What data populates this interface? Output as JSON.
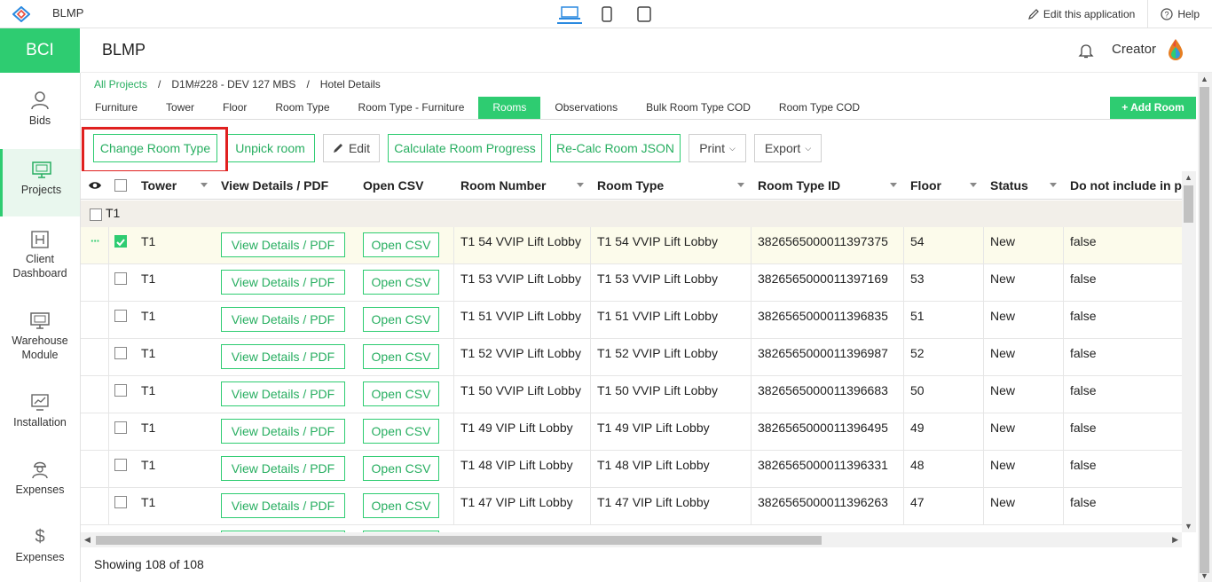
{
  "app": {
    "name": "BLMP",
    "edit_label": "Edit this application",
    "help_label": "Help",
    "brand": "BCI",
    "page_title": "BLMP",
    "user_label": "Creator"
  },
  "sidebar": {
    "items": [
      {
        "label": "Bids",
        "icon": "person-icon"
      },
      {
        "label": "Projects",
        "icon": "monitor-icon"
      },
      {
        "label": "Client Dashboard",
        "icon": "h-icon"
      },
      {
        "label": "Warehouse Module",
        "icon": "monitor-icon"
      },
      {
        "label": "Installation",
        "icon": "chart-icon"
      },
      {
        "label": "Expenses",
        "icon": "worker-icon"
      },
      {
        "label": "Expenses",
        "icon": "dollar-icon"
      }
    ]
  },
  "breadcrumb": {
    "root": "All Projects",
    "sep": "/",
    "project": "D1M#228 - DEV 127 MBS",
    "page": "Hotel Details"
  },
  "tabs": [
    "Furniture",
    "Tower",
    "Floor",
    "Room Type",
    "Room Type - Furniture",
    "Rooms",
    "Observations",
    "Bulk Room Type COD",
    "Room Type COD"
  ],
  "add_room_label": "+ Add Room",
  "toolbar": {
    "change_room_type": "Change Room Type",
    "unpick_room": "Unpick room",
    "edit": "Edit",
    "calculate": "Calculate Room Progress",
    "recalc": "Re-Calc Room JSON",
    "print": "Print",
    "export": "Export"
  },
  "grid": {
    "columns": [
      "Tower",
      "View Details / PDF",
      "Open CSV",
      "Room Number",
      "Room Type",
      "Room Type ID",
      "Floor",
      "Status",
      "Do not include in pe"
    ],
    "group_label": "T1",
    "view_btn": "View Details / PDF",
    "csv_btn": "Open CSV",
    "rows": [
      {
        "tower": "T1",
        "room_number": "T1 54 VVIP Lift Lobby",
        "room_type": "T1 54 VVIP Lift Lobby",
        "room_type_id": "3826565000011397375",
        "floor": "54",
        "status": "New",
        "exclude": "false"
      },
      {
        "tower": "T1",
        "room_number": "T1 53 VVIP Lift Lobby",
        "room_type": "T1 53 VVIP Lift Lobby",
        "room_type_id": "3826565000011397169",
        "floor": "53",
        "status": "New",
        "exclude": "false"
      },
      {
        "tower": "T1",
        "room_number": "T1 51 VVIP Lift Lobby",
        "room_type": "T1 51 VVIP Lift Lobby",
        "room_type_id": "3826565000011396835",
        "floor": "51",
        "status": "New",
        "exclude": "false"
      },
      {
        "tower": "T1",
        "room_number": "T1 52 VVIP Lift Lobby",
        "room_type": "T1 52 VVIP Lift Lobby",
        "room_type_id": "3826565000011396987",
        "floor": "52",
        "status": "New",
        "exclude": "false"
      },
      {
        "tower": "T1",
        "room_number": "T1 50 VVIP Lift Lobby",
        "room_type": "T1 50 VVIP Lift Lobby",
        "room_type_id": "3826565000011396683",
        "floor": "50",
        "status": "New",
        "exclude": "false"
      },
      {
        "tower": "T1",
        "room_number": "T1 49 VIP Lift Lobby",
        "room_type": "T1 49 VIP Lift Lobby",
        "room_type_id": "3826565000011396495",
        "floor": "49",
        "status": "New",
        "exclude": "false"
      },
      {
        "tower": "T1",
        "room_number": "T1 48 VIP Lift Lobby",
        "room_type": "T1 48 VIP Lift Lobby",
        "room_type_id": "3826565000011396331",
        "floor": "48",
        "status": "New",
        "exclude": "false"
      },
      {
        "tower": "T1",
        "room_number": "T1 47 VIP Lift Lobby",
        "room_type": "T1 47 VIP Lift Lobby",
        "room_type_id": "3826565000011396263",
        "floor": "47",
        "status": "New",
        "exclude": "false"
      }
    ]
  },
  "footer": "Showing 108 of 108",
  "colors": {
    "accent": "#2ecc71",
    "highlight": "#e0201f"
  }
}
